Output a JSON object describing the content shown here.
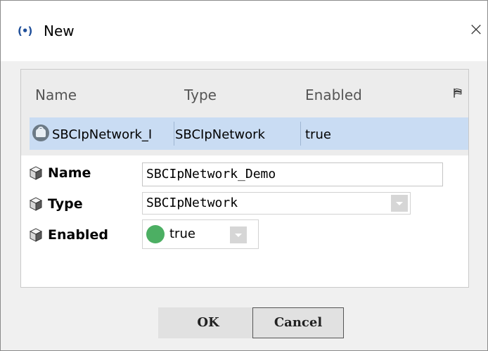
{
  "window": {
    "title": "New",
    "title_icon": "(•)",
    "close_glyph": "×"
  },
  "table": {
    "columns": [
      "Name",
      "Type",
      "Enabled"
    ],
    "column_options_icon": "column-options-icon",
    "rows": [
      {
        "icon": "network-icon",
        "name": "SBCIpNetwork_I",
        "type": "SBCIpNetwork",
        "enabled": "true",
        "selected": true
      }
    ]
  },
  "properties": {
    "name": {
      "label": "Name",
      "value": "SBCIpNetwork_Demo"
    },
    "type": {
      "label": "Type",
      "value": "SBCIpNetwork"
    },
    "enabled": {
      "label": "Enabled",
      "value": "true",
      "status_color": "#4caf63"
    }
  },
  "buttons": {
    "ok": "OK",
    "cancel": "Cancel"
  },
  "colors": {
    "selection": "#c9dcf3",
    "header_bg": "#ececec",
    "title_icon": "#1f4f9a"
  }
}
